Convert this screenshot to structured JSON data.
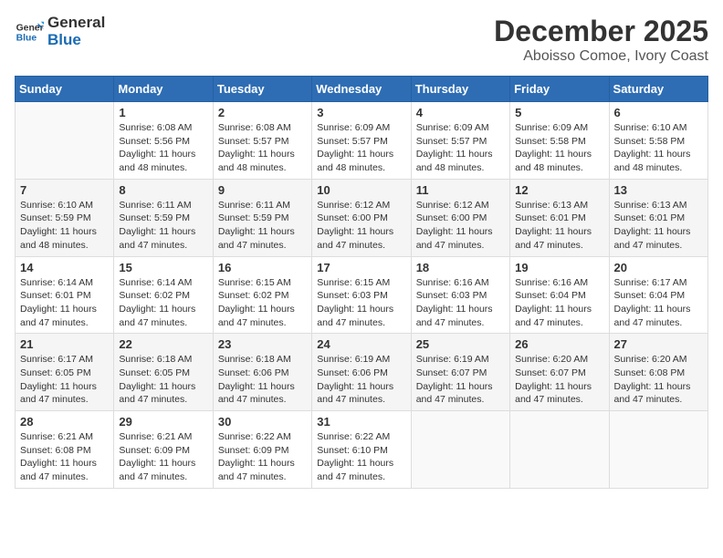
{
  "header": {
    "logo_general": "General",
    "logo_blue": "Blue",
    "month": "December 2025",
    "location": "Aboisso Comoe, Ivory Coast"
  },
  "days_of_week": [
    "Sunday",
    "Monday",
    "Tuesday",
    "Wednesday",
    "Thursday",
    "Friday",
    "Saturday"
  ],
  "weeks": [
    [
      {
        "day": "",
        "sunrise": "",
        "sunset": "",
        "daylight": ""
      },
      {
        "day": "1",
        "sunrise": "6:08 AM",
        "sunset": "5:56 PM",
        "daylight": "11 hours and 48 minutes."
      },
      {
        "day": "2",
        "sunrise": "6:08 AM",
        "sunset": "5:57 PM",
        "daylight": "11 hours and 48 minutes."
      },
      {
        "day": "3",
        "sunrise": "6:09 AM",
        "sunset": "5:57 PM",
        "daylight": "11 hours and 48 minutes."
      },
      {
        "day": "4",
        "sunrise": "6:09 AM",
        "sunset": "5:57 PM",
        "daylight": "11 hours and 48 minutes."
      },
      {
        "day": "5",
        "sunrise": "6:09 AM",
        "sunset": "5:58 PM",
        "daylight": "11 hours and 48 minutes."
      },
      {
        "day": "6",
        "sunrise": "6:10 AM",
        "sunset": "5:58 PM",
        "daylight": "11 hours and 48 minutes."
      }
    ],
    [
      {
        "day": "7",
        "sunrise": "6:10 AM",
        "sunset": "5:59 PM",
        "daylight": "11 hours and 48 minutes."
      },
      {
        "day": "8",
        "sunrise": "6:11 AM",
        "sunset": "5:59 PM",
        "daylight": "11 hours and 47 minutes."
      },
      {
        "day": "9",
        "sunrise": "6:11 AM",
        "sunset": "5:59 PM",
        "daylight": "11 hours and 47 minutes."
      },
      {
        "day": "10",
        "sunrise": "6:12 AM",
        "sunset": "6:00 PM",
        "daylight": "11 hours and 47 minutes."
      },
      {
        "day": "11",
        "sunrise": "6:12 AM",
        "sunset": "6:00 PM",
        "daylight": "11 hours and 47 minutes."
      },
      {
        "day": "12",
        "sunrise": "6:13 AM",
        "sunset": "6:01 PM",
        "daylight": "11 hours and 47 minutes."
      },
      {
        "day": "13",
        "sunrise": "6:13 AM",
        "sunset": "6:01 PM",
        "daylight": "11 hours and 47 minutes."
      }
    ],
    [
      {
        "day": "14",
        "sunrise": "6:14 AM",
        "sunset": "6:01 PM",
        "daylight": "11 hours and 47 minutes."
      },
      {
        "day": "15",
        "sunrise": "6:14 AM",
        "sunset": "6:02 PM",
        "daylight": "11 hours and 47 minutes."
      },
      {
        "day": "16",
        "sunrise": "6:15 AM",
        "sunset": "6:02 PM",
        "daylight": "11 hours and 47 minutes."
      },
      {
        "day": "17",
        "sunrise": "6:15 AM",
        "sunset": "6:03 PM",
        "daylight": "11 hours and 47 minutes."
      },
      {
        "day": "18",
        "sunrise": "6:16 AM",
        "sunset": "6:03 PM",
        "daylight": "11 hours and 47 minutes."
      },
      {
        "day": "19",
        "sunrise": "6:16 AM",
        "sunset": "6:04 PM",
        "daylight": "11 hours and 47 minutes."
      },
      {
        "day": "20",
        "sunrise": "6:17 AM",
        "sunset": "6:04 PM",
        "daylight": "11 hours and 47 minutes."
      }
    ],
    [
      {
        "day": "21",
        "sunrise": "6:17 AM",
        "sunset": "6:05 PM",
        "daylight": "11 hours and 47 minutes."
      },
      {
        "day": "22",
        "sunrise": "6:18 AM",
        "sunset": "6:05 PM",
        "daylight": "11 hours and 47 minutes."
      },
      {
        "day": "23",
        "sunrise": "6:18 AM",
        "sunset": "6:06 PM",
        "daylight": "11 hours and 47 minutes."
      },
      {
        "day": "24",
        "sunrise": "6:19 AM",
        "sunset": "6:06 PM",
        "daylight": "11 hours and 47 minutes."
      },
      {
        "day": "25",
        "sunrise": "6:19 AM",
        "sunset": "6:07 PM",
        "daylight": "11 hours and 47 minutes."
      },
      {
        "day": "26",
        "sunrise": "6:20 AM",
        "sunset": "6:07 PM",
        "daylight": "11 hours and 47 minutes."
      },
      {
        "day": "27",
        "sunrise": "6:20 AM",
        "sunset": "6:08 PM",
        "daylight": "11 hours and 47 minutes."
      }
    ],
    [
      {
        "day": "28",
        "sunrise": "6:21 AM",
        "sunset": "6:08 PM",
        "daylight": "11 hours and 47 minutes."
      },
      {
        "day": "29",
        "sunrise": "6:21 AM",
        "sunset": "6:09 PM",
        "daylight": "11 hours and 47 minutes."
      },
      {
        "day": "30",
        "sunrise": "6:22 AM",
        "sunset": "6:09 PM",
        "daylight": "11 hours and 47 minutes."
      },
      {
        "day": "31",
        "sunrise": "6:22 AM",
        "sunset": "6:10 PM",
        "daylight": "11 hours and 47 minutes."
      },
      {
        "day": "",
        "sunrise": "",
        "sunset": "",
        "daylight": ""
      },
      {
        "day": "",
        "sunrise": "",
        "sunset": "",
        "daylight": ""
      },
      {
        "day": "",
        "sunrise": "",
        "sunset": "",
        "daylight": ""
      }
    ]
  ],
  "labels": {
    "sunrise_prefix": "Sunrise: ",
    "sunset_prefix": "Sunset: ",
    "daylight_prefix": "Daylight: "
  }
}
